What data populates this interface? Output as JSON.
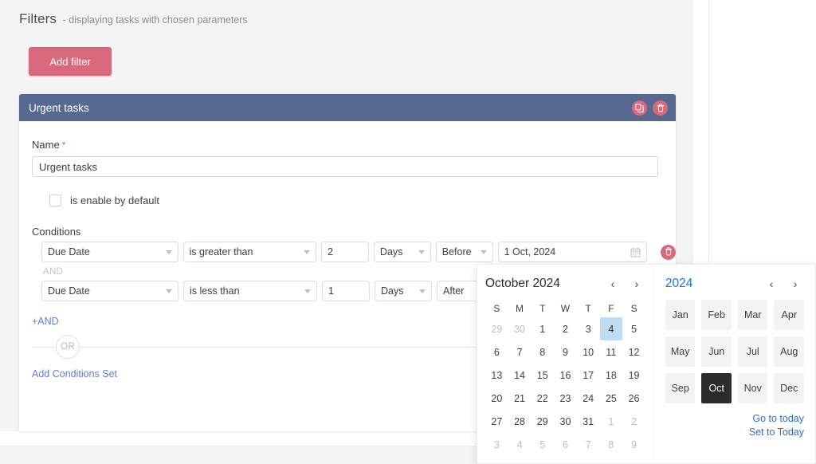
{
  "header": {
    "title": "Filters",
    "subtitle": "- displaying tasks with chosen parameters",
    "add_filter_label": "Add filter"
  },
  "filter_card": {
    "header_title": "Urgent tasks",
    "duplicate_icon": "copy-icon",
    "delete_icon": "trash-icon",
    "name_label": "Name",
    "name_required_marker": "*",
    "name_value": "Urgent tasks",
    "enable_label": "is enable by default",
    "enable_checked": false,
    "conditions_label": "Conditions",
    "and_separator": "AND",
    "add_and_label": "+AND",
    "or_label": "OR",
    "add_conditions_set_label": "Add Conditions Set",
    "conditions": [
      {
        "field": "Due Date",
        "operator": "is greater than",
        "amount": "2",
        "unit": "Days",
        "direction": "Before",
        "date": "1 Oct, 2024",
        "has_date": true,
        "calendar_icon": "calendar-icon",
        "delete_icon": "trash-icon"
      },
      {
        "field": "Due Date",
        "operator": "is less than",
        "amount": "1",
        "unit": "Days",
        "direction": "After",
        "date": "",
        "has_date": false
      }
    ]
  },
  "datepicker": {
    "month_year": "October 2024",
    "prev_month_icon": "chevron-left-icon",
    "next_month_icon": "chevron-right-icon",
    "weekdays": [
      "S",
      "M",
      "T",
      "W",
      "T",
      "F",
      "S"
    ],
    "selected_day": 4,
    "days": [
      {
        "n": "29",
        "muted": true
      },
      {
        "n": "30",
        "muted": true
      },
      {
        "n": "1"
      },
      {
        "n": "2"
      },
      {
        "n": "3"
      },
      {
        "n": "4",
        "selected": true
      },
      {
        "n": "5"
      },
      {
        "n": "6"
      },
      {
        "n": "7"
      },
      {
        "n": "8"
      },
      {
        "n": "9"
      },
      {
        "n": "10"
      },
      {
        "n": "11"
      },
      {
        "n": "12"
      },
      {
        "n": "13"
      },
      {
        "n": "14"
      },
      {
        "n": "15"
      },
      {
        "n": "16"
      },
      {
        "n": "17"
      },
      {
        "n": "18"
      },
      {
        "n": "19"
      },
      {
        "n": "20"
      },
      {
        "n": "21"
      },
      {
        "n": "22"
      },
      {
        "n": "23"
      },
      {
        "n": "24"
      },
      {
        "n": "25"
      },
      {
        "n": "26"
      },
      {
        "n": "27"
      },
      {
        "n": "28"
      },
      {
        "n": "29"
      },
      {
        "n": "30"
      },
      {
        "n": "31"
      },
      {
        "n": "1",
        "muted": true
      },
      {
        "n": "2",
        "muted": true
      },
      {
        "n": "3",
        "muted": true
      },
      {
        "n": "4",
        "muted": true
      },
      {
        "n": "5",
        "muted": true
      },
      {
        "n": "6",
        "muted": true
      },
      {
        "n": "7",
        "muted": true
      },
      {
        "n": "8",
        "muted": true
      },
      {
        "n": "9",
        "muted": true
      }
    ],
    "year": "2024",
    "prev_year_icon": "chevron-left-icon",
    "next_year_icon": "chevron-right-icon",
    "months": [
      "Jan",
      "Feb",
      "Mar",
      "Apr",
      "May",
      "Jun",
      "Jul",
      "Aug",
      "Sep",
      "Oct",
      "Nov",
      "Dec"
    ],
    "selected_month": "Oct",
    "go_to_today_label": "Go to today",
    "set_to_today_label": "Set to Today"
  },
  "colors": {
    "accent_red": "#d9697c",
    "card_header_blue": "#566a91",
    "link_blue": "#5b7fd4",
    "year_blue": "#1a73e8",
    "selected_day_bg": "#bfdcf5",
    "selected_month_bg": "#2b2b2b",
    "page_bg": "#f4f4f4"
  }
}
